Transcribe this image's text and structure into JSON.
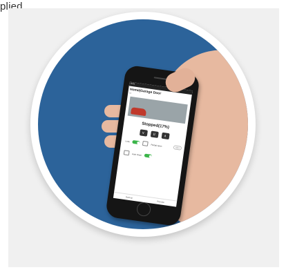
{
  "caption": "plied",
  "phone_screen": {
    "status_bar": "9:41",
    "title": "Home|Garage Door",
    "subtitle": "ID",
    "status": "Stopped(17%)",
    "controls": [
      "∨",
      "II",
      "∧"
    ],
    "alert_pill": "Alert",
    "rows": [
      {
        "left": "Lock",
        "right": "Partial open"
      },
      {
        "left": "Auto close",
        "right": ""
      }
    ],
    "tabs": [
      "Backup",
      "Remote"
    ]
  }
}
